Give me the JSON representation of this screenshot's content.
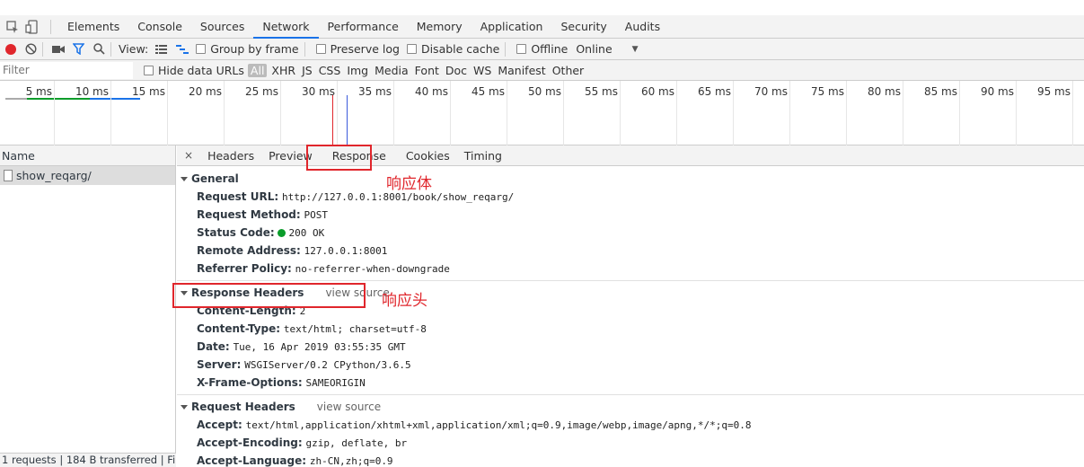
{
  "main_tabs": [
    "Elements",
    "Console",
    "Sources",
    "Network",
    "Performance",
    "Memory",
    "Application",
    "Security",
    "Audits"
  ],
  "active_tab": "Network",
  "toolbar": {
    "view_label": "View:",
    "group_by_frame": "Group by frame",
    "preserve_log": "Preserve log",
    "disable_cache": "Disable cache",
    "offline": "Offline",
    "throttle": "Online"
  },
  "filter": {
    "placeholder": "Filter",
    "hide_data_urls": "Hide data URLs",
    "types": [
      "All",
      "XHR",
      "JS",
      "CSS",
      "Img",
      "Media",
      "Font",
      "Doc",
      "WS",
      "Manifest",
      "Other"
    ]
  },
  "timeline_ticks": [
    "5 ms",
    "10 ms",
    "15 ms",
    "20 ms",
    "25 ms",
    "30 ms",
    "35 ms",
    "40 ms",
    "45 ms",
    "50 ms",
    "55 ms",
    "60 ms",
    "65 ms",
    "70 ms",
    "75 ms",
    "80 ms",
    "85 ms",
    "90 ms",
    "95 ms"
  ],
  "request_list": {
    "header": "Name",
    "items": [
      "show_reqarg/"
    ],
    "status": "1 requests | 184 B transferred | Fi..."
  },
  "detail_tabs": [
    "Headers",
    "Preview",
    "Response",
    "Cookies",
    "Timing"
  ],
  "general": {
    "title": "General",
    "rows": [
      {
        "k": "Request URL:",
        "v": "http://127.0.0.1:8001/book/show_reqarg/"
      },
      {
        "k": "Request Method:",
        "v": "POST"
      },
      {
        "k": "Status Code:",
        "v": "200 OK"
      },
      {
        "k": "Remote Address:",
        "v": "127.0.0.1:8001"
      },
      {
        "k": "Referrer Policy:",
        "v": "no-referrer-when-downgrade"
      }
    ]
  },
  "response_headers": {
    "title": "Response Headers",
    "view_source": "view source",
    "rows": [
      {
        "k": "Content-Length:",
        "v": "2"
      },
      {
        "k": "Content-Type:",
        "v": "text/html; charset=utf-8"
      },
      {
        "k": "Date:",
        "v": "Tue, 16 Apr 2019 03:55:35 GMT"
      },
      {
        "k": "Server:",
        "v": "WSGIServer/0.2 CPython/3.6.5"
      },
      {
        "k": "X-Frame-Options:",
        "v": "SAMEORIGIN"
      }
    ]
  },
  "request_headers": {
    "title": "Request Headers",
    "view_source": "view source",
    "rows": [
      {
        "k": "Accept:",
        "v": "text/html,application/xhtml+xml,application/xml;q=0.9,image/webp,image/apng,*/*;q=0.8"
      },
      {
        "k": "Accept-Encoding:",
        "v": "gzip, deflate, br"
      },
      {
        "k": "Accept-Language:",
        "v": "zh-CN,zh;q=0.9"
      }
    ]
  },
  "annotations": {
    "response_body": "响应体",
    "response_head": "响应头"
  },
  "colors": {
    "annotation": "#e0262c",
    "active_tab": "#1a73e8",
    "record": "#e0262c",
    "status_ok": "#0a9c2a"
  }
}
